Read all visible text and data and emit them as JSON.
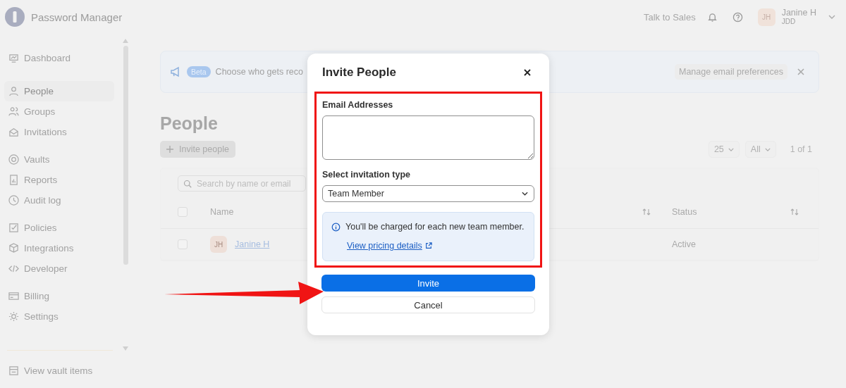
{
  "app": {
    "name": "Password Manager"
  },
  "header": {
    "talk_to_sales": "Talk to Sales",
    "user": {
      "initials": "JH",
      "name": "Janine H",
      "org": "JDD"
    }
  },
  "sidebar": {
    "groups": [
      [
        {
          "label": "Dashboard",
          "selected": false
        }
      ],
      [
        {
          "label": "People",
          "selected": true
        },
        {
          "label": "Groups",
          "selected": false
        },
        {
          "label": "Invitations",
          "selected": false
        }
      ],
      [
        {
          "label": "Vaults",
          "selected": false
        },
        {
          "label": "Reports",
          "selected": false
        },
        {
          "label": "Audit log",
          "selected": false
        }
      ],
      [
        {
          "label": "Policies",
          "selected": false
        },
        {
          "label": "Integrations",
          "selected": false
        },
        {
          "label": "Developer",
          "selected": false
        }
      ],
      [
        {
          "label": "Billing",
          "selected": false
        },
        {
          "label": "Settings",
          "selected": false
        }
      ]
    ],
    "footer_item": "View vault items"
  },
  "banner": {
    "badge": "Beta",
    "text": "Choose who gets reco",
    "action": "Manage email preferences"
  },
  "page": {
    "title": "People",
    "invite_button": "Invite people"
  },
  "table": {
    "search_placeholder": "Search by name or email",
    "per_page": "25",
    "filter": "All",
    "pagination": "1 of 1",
    "select_all_checked": false,
    "columns": [
      {
        "label": "Name",
        "sortable": false
      },
      {
        "sortable": true
      },
      {
        "label": "Status",
        "sortable": true
      }
    ],
    "rows": [
      {
        "checked": false,
        "initials": "JH",
        "name": "Janine H",
        "status": "Active"
      }
    ]
  },
  "dialog": {
    "title": "Invite People",
    "email_label": "Email Addresses",
    "type_label": "Select invitation type",
    "type_value": "Team Member",
    "info_text": "You'll be charged for each new team member.",
    "info_link": "View pricing details",
    "primary_button": "Invite",
    "secondary_button": "Cancel"
  }
}
